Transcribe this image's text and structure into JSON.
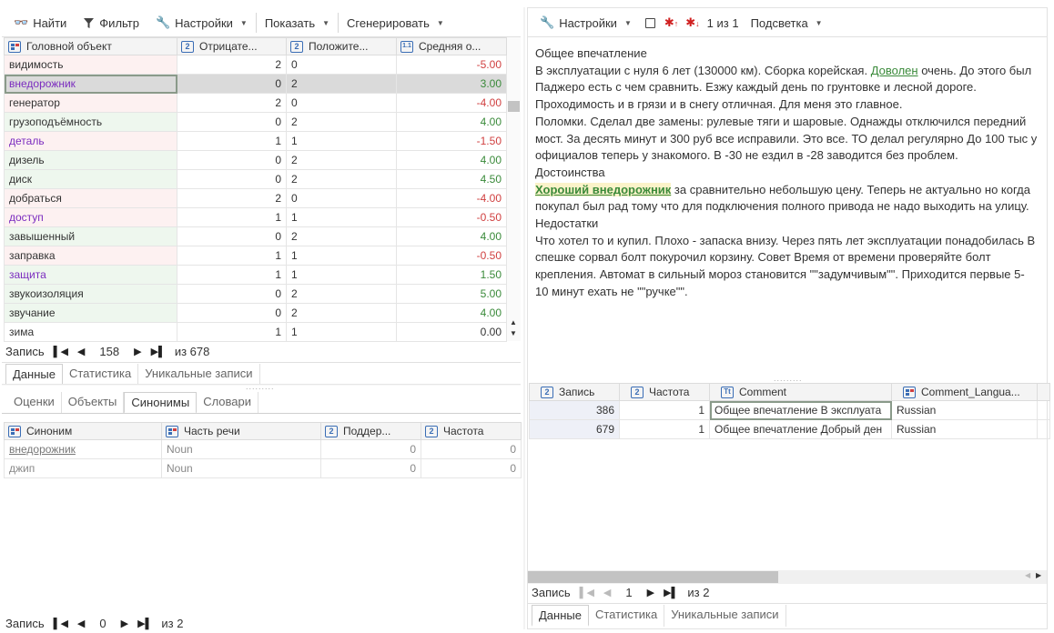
{
  "left_toolbar": {
    "find": "Найти",
    "filter": "Фильтр",
    "settings": "Настройки",
    "show": "Показать",
    "generate": "Сгенерировать"
  },
  "left_grid": {
    "headers": [
      "Головной объект",
      "Отрицате...",
      "Положите...",
      "Средняя о..."
    ],
    "header_icons": [
      "",
      "2",
      "2",
      "1.1"
    ],
    "rows": [
      {
        "word": "видимость",
        "neg": "2",
        "pos": "0",
        "avg": "-5.00"
      },
      {
        "word": "внедорожник",
        "neg": "0",
        "pos": "2",
        "avg": "3.00"
      },
      {
        "word": "генератор",
        "neg": "2",
        "pos": "0",
        "avg": "-4.00"
      },
      {
        "word": "грузоподъёмность",
        "neg": "0",
        "pos": "2",
        "avg": "4.00"
      },
      {
        "word": "деталь",
        "neg": "1",
        "pos": "1",
        "avg": "-1.50"
      },
      {
        "word": "дизель",
        "neg": "0",
        "pos": "2",
        "avg": "4.00"
      },
      {
        "word": "диск",
        "neg": "0",
        "pos": "2",
        "avg": "4.50"
      },
      {
        "word": "добраться",
        "neg": "2",
        "pos": "0",
        "avg": "-4.00"
      },
      {
        "word": "доступ",
        "neg": "1",
        "pos": "1",
        "avg": "-0.50"
      },
      {
        "word": "завышенный",
        "neg": "0",
        "pos": "2",
        "avg": "4.00"
      },
      {
        "word": "заправка",
        "neg": "1",
        "pos": "1",
        "avg": "-0.50"
      },
      {
        "word": "защита",
        "neg": "1",
        "pos": "1",
        "avg": "1.50"
      },
      {
        "word": "звукоизоляция",
        "neg": "0",
        "pos": "2",
        "avg": "5.00"
      },
      {
        "word": "звучание",
        "neg": "0",
        "pos": "2",
        "avg": "4.00"
      },
      {
        "word": "зима",
        "neg": "1",
        "pos": "1",
        "avg": "0.00"
      }
    ]
  },
  "left_pager": {
    "label": "Запись",
    "current": "158",
    "total": "из 678"
  },
  "left_tabs": [
    "Данные",
    "Статистика",
    "Уникальные записи"
  ],
  "lower_tabs": [
    "Оценки",
    "Объекты",
    "Синонимы",
    "Словари"
  ],
  "synonyms_grid": {
    "headers": [
      "Синоним",
      "Часть речи",
      "Поддер...",
      "Частота"
    ],
    "header_icons": [
      "",
      "",
      "2",
      "2"
    ],
    "rows": [
      {
        "syn": "внедорожник",
        "pos": "Noun",
        "sup": "0",
        "freq": "0"
      },
      {
        "syn": "джип",
        "pos": "Noun",
        "sup": "0",
        "freq": "0"
      }
    ]
  },
  "bottom_pager": {
    "label": "Запись",
    "current": "0",
    "total": "из 2"
  },
  "right_toolbar": {
    "settings": "Настройки",
    "counter": "1 из 1",
    "highlight": "Подсветка"
  },
  "review": {
    "line1": "Общее впечатление",
    "p1_a": "В эксплуатации с нуля 6 лет (130000 км). Сборка корейская. ",
    "p1_hl": "Доволен",
    "p1_b": " очень. До этого был Паджеро есть с чем сравнить. Езжу каждый день по грунтовке и лесной дороге. Проходимость и в грязи и в снегу отличная. Для меня это главное.",
    "p2": "Поломки. Сделал две замены: рулевые тяги и шаровые. Однажды отключился передний мост. За десять минут и 300 руб все исправили. Это все. ТО делал регулярно До 100 тыс у официалов теперь у знакомого. В -30 не ездил в -28 заводится без проблем.",
    "h_adv": "Достоинства",
    "adv_hl": "Хороший внедорожник",
    "adv_rest": " за сравнительно небольшую цену. Теперь не актуально но когда покупал был рад тому что для подключения полного привода не надо выходить на улицу.",
    "h_dis": "Недостатки",
    "dis": "Что хотел то и купил. Плохо - запаска внизу. Через пять лет эксплуатации понадобилась В спешке сорвал болт покурочил корзину. Совет Время от времени проверяйте болт крепления. Автомат в сильный мороз становится \"\"задумчивым\"\". Приходится первые 5-10 минут ехать не \"\"ручке\"\"."
  },
  "records_grid": {
    "headers": [
      "Запись",
      "Частота",
      "Comment",
      "Comment_Langua..."
    ],
    "rows": [
      {
        "rec": "386",
        "freq": "1",
        "comment": "Общее впечатление В эксплуата",
        "lang": "Russian"
      },
      {
        "rec": "679",
        "freq": "1",
        "comment": "Общее впечатление Добрый ден",
        "lang": "Russian"
      }
    ]
  },
  "right_pager": {
    "label": "Запись",
    "current": "1",
    "total": "из 2"
  },
  "right_tabs": [
    "Данные",
    "Статистика",
    "Уникальные записи"
  ]
}
